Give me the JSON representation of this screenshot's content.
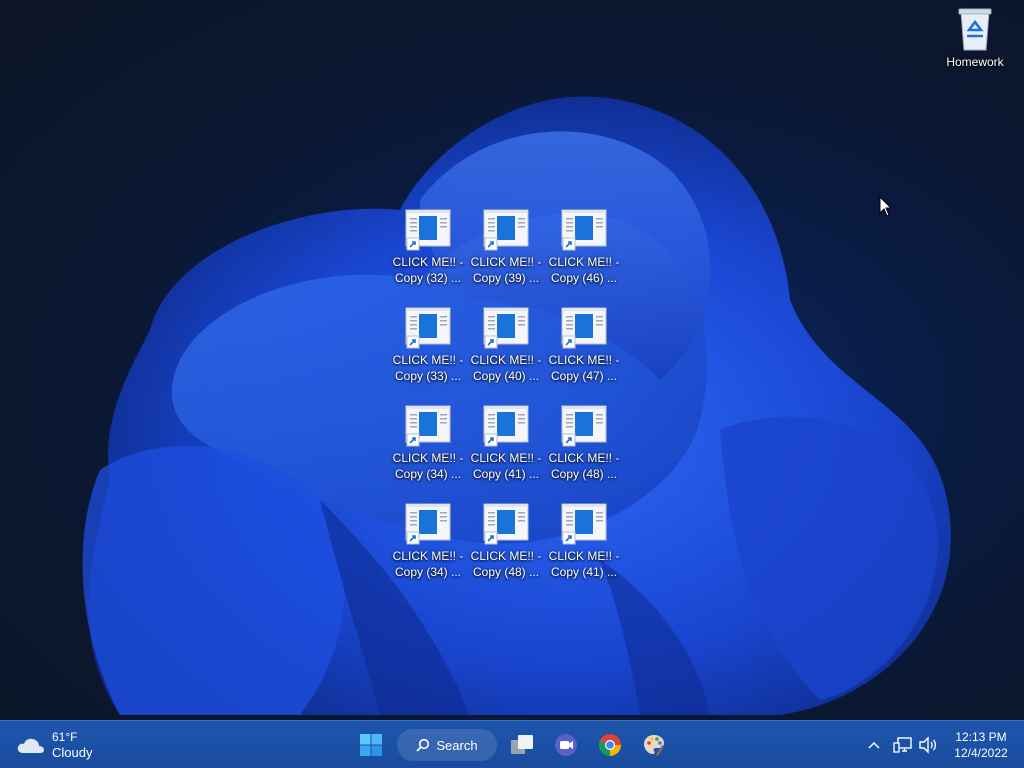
{
  "desktop": {
    "recycle_bin": {
      "label": "Homework",
      "icon": "recycle-bin-icon"
    },
    "shortcut_icon": "shortcut-file-icon",
    "shortcuts": [
      {
        "label": "CLICK ME!! -\nCopy (32) ..."
      },
      {
        "label": "CLICK ME!! -\nCopy (39) ..."
      },
      {
        "label": "CLICK ME!! -\nCopy (46) ..."
      },
      {
        "label": "CLICK ME!! -\nCopy (33) ..."
      },
      {
        "label": "CLICK ME!! -\nCopy (40) ..."
      },
      {
        "label": "CLICK ME!! -\nCopy (47) ..."
      },
      {
        "label": "CLICK ME!! -\nCopy (34) ..."
      },
      {
        "label": "CLICK ME!! -\nCopy (41) ..."
      },
      {
        "label": "CLICK ME!! -\nCopy (48) ..."
      },
      {
        "label": "CLICK ME!! -\nCopy (34) ..."
      },
      {
        "label": "CLICK ME!! -\nCopy (48) ..."
      },
      {
        "label": "CLICK ME!! -\nCopy (41) ..."
      }
    ]
  },
  "taskbar": {
    "weather": {
      "temp": "61°F",
      "condition": "Cloudy",
      "icon": "cloud-icon"
    },
    "search_label": "Search",
    "apps": [
      "start-icon",
      "search-icon",
      "task-view-icon",
      "meet-icon",
      "chrome-icon",
      "paint-icon"
    ],
    "tray": {
      "icons": [
        "chevron-up-icon",
        "network-icon",
        "volume-icon"
      ],
      "time": "12:13 PM",
      "date": "12/4/2022"
    }
  },
  "colors": {
    "taskbar": "#1a4fa3",
    "desktop_bg": "#0b1730",
    "bloom_blue": "#1f5bff"
  }
}
